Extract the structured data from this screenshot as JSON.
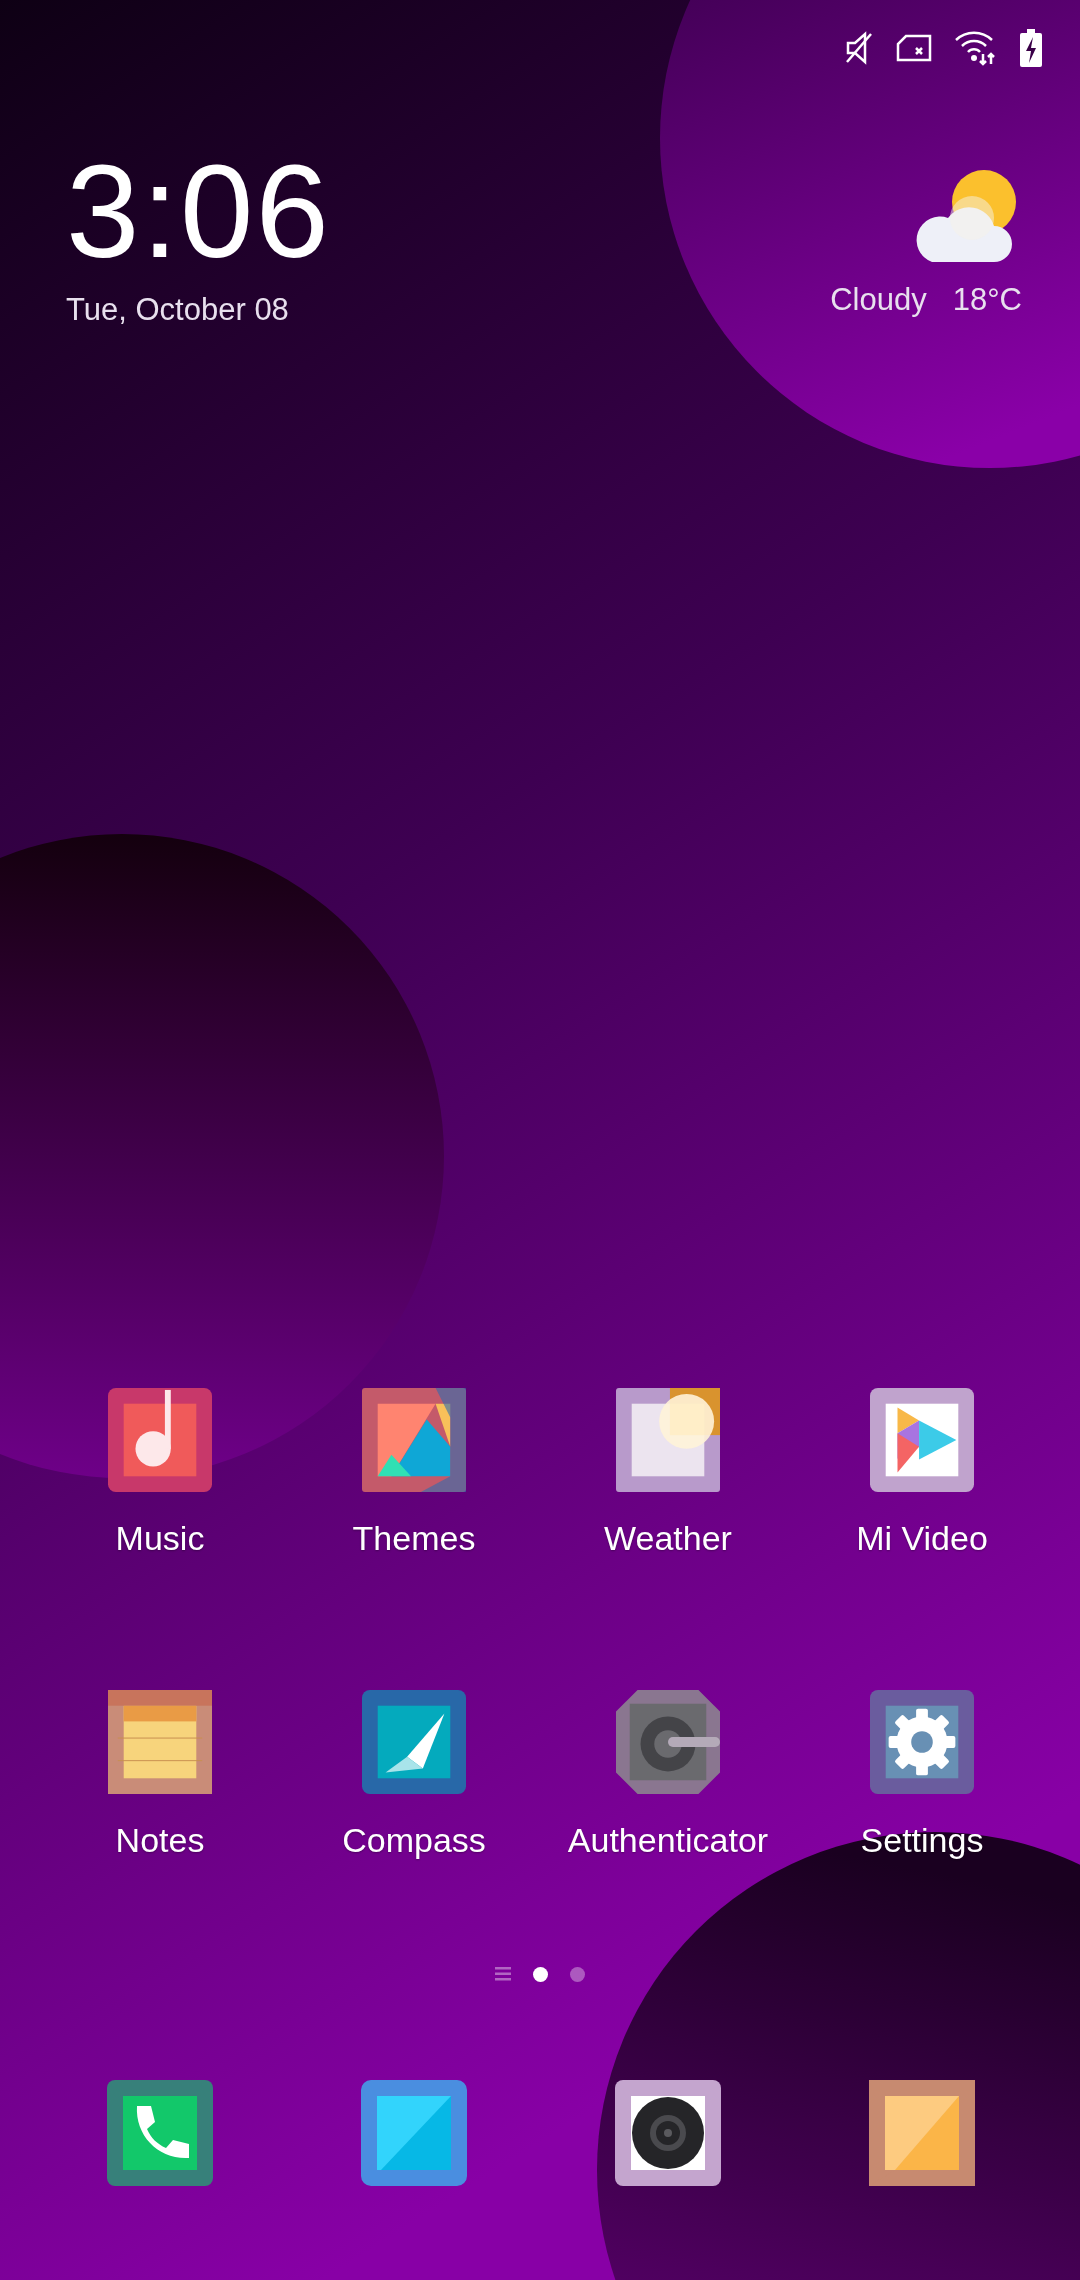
{
  "clock": {
    "time": "3:06",
    "date": "Tue, October 08"
  },
  "weather": {
    "condition": "Cloudy",
    "temperature": "18°C"
  },
  "apps": [
    {
      "label": "Music"
    },
    {
      "label": "Themes"
    },
    {
      "label": "Weather"
    },
    {
      "label": "Mi Video"
    },
    {
      "label": "Notes"
    },
    {
      "label": "Compass"
    },
    {
      "label": "Authenticator"
    },
    {
      "label": "Settings"
    }
  ],
  "page_indicator": [
    {
      "kind": "menu",
      "selected": false
    },
    {
      "kind": "dot",
      "selected": true
    },
    {
      "kind": "dot",
      "selected": false
    }
  ]
}
